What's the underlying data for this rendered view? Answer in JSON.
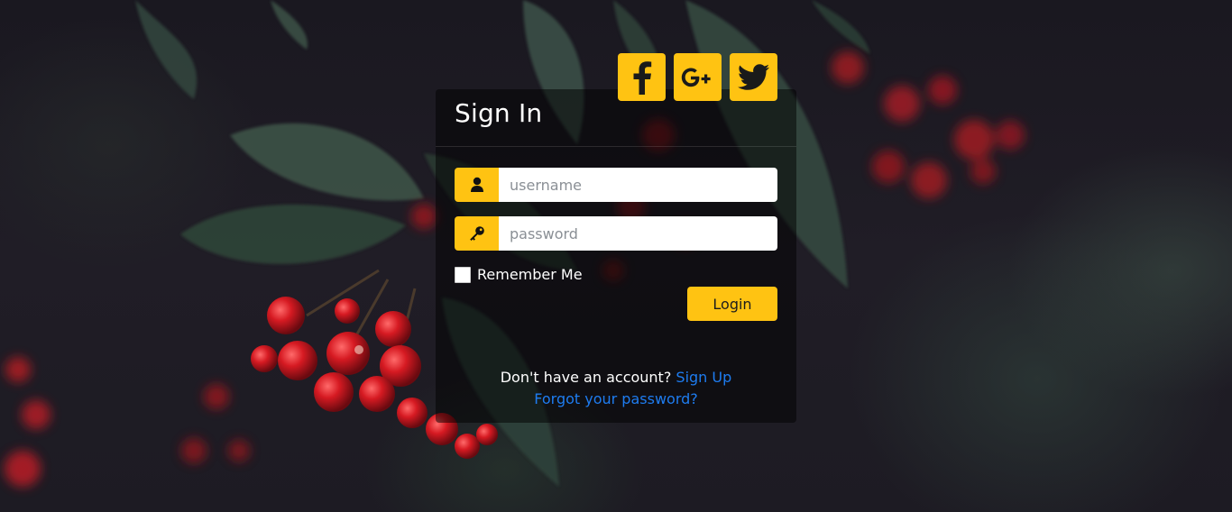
{
  "title": "Sign In",
  "social": [
    {
      "name": "facebook",
      "label": "f",
      "icon": "facebook-icon"
    },
    {
      "name": "google-plus",
      "label": "G+",
      "icon": "google-plus-icon"
    },
    {
      "name": "twitter",
      "label": "",
      "icon": "twitter-icon"
    }
  ],
  "form": {
    "username": {
      "placeholder": "username",
      "value": "",
      "icon": "user-icon"
    },
    "password": {
      "placeholder": "password",
      "value": "",
      "icon": "key-icon"
    },
    "remember_label": "Remember Me",
    "remember_checked": false,
    "login_label": "Login"
  },
  "footer": {
    "no_account_text": "Don't have an account?",
    "signup_link": "Sign Up",
    "forgot_link": "Forgot your password?"
  },
  "colors": {
    "accent": "#ffc312",
    "link": "#1e7cf0",
    "card_overlay": "rgba(0,0,0,0.5)"
  }
}
